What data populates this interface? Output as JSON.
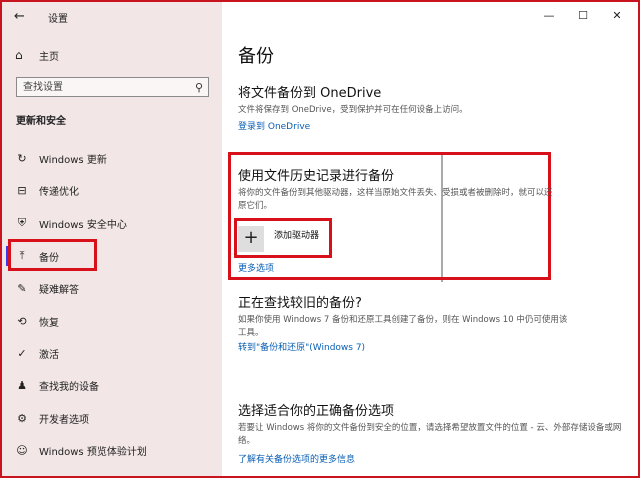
{
  "window": {
    "title": "设置",
    "controls": {
      "minimize": "—",
      "maximize": "☐",
      "close": "✕"
    }
  },
  "sidebar": {
    "back_icon": "←",
    "home_label": "主页",
    "search_placeholder": "查找设置",
    "section_title": "更新和安全",
    "items": [
      {
        "label": "Windows 更新",
        "icon": "refresh-icon",
        "glyph": "↻"
      },
      {
        "label": "传递优化",
        "icon": "delivery-icon",
        "glyph": "⊟"
      },
      {
        "label": "Windows 安全中心",
        "icon": "shield-icon",
        "glyph": "⛨"
      },
      {
        "label": "备份",
        "icon": "backup-icon",
        "glyph": "⤒",
        "selected": true
      },
      {
        "label": "疑难解答",
        "icon": "wrench-icon",
        "glyph": "✎"
      },
      {
        "label": "恢复",
        "icon": "recovery-icon",
        "glyph": "⟲"
      },
      {
        "label": "激活",
        "icon": "activation-icon",
        "glyph": "✓"
      },
      {
        "label": "查找我的设备",
        "icon": "find-device-icon",
        "glyph": "♟"
      },
      {
        "label": "开发者选项",
        "icon": "developer-icon",
        "glyph": "⚙"
      },
      {
        "label": "Windows 预览体验计划",
        "icon": "insider-icon",
        "glyph": "☺"
      }
    ]
  },
  "main": {
    "title": "备份",
    "onedrive": {
      "heading": "将文件备份到 OneDrive",
      "description": "文件将保存到 OneDrive，受到保护并可在任何设备上访问。",
      "link": "登录到 OneDrive"
    },
    "file_history": {
      "heading": "使用文件历史记录进行备份",
      "description": "将你的文件备份到其他驱动器，这样当原始文件丢失、受损或者被删除时，就可以还原它们。",
      "add_drive_glyph": "+",
      "add_drive_label": "添加驱动器",
      "more_options": "更多选项"
    },
    "older_backup": {
      "heading": "正在查找较旧的备份?",
      "description": "如果你使用 Windows 7 备份和还原工具创建了备份，则在 Windows 10 中仍可使用该工具。",
      "link": "转到\"备份和还原\"(Windows 7)"
    },
    "choose": {
      "heading": "选择适合你的正确备份选项",
      "description": "若要让 Windows 将你的文件备份到安全的位置，请选择希望放置文件的位置 - 云、外部存储设备或网络。",
      "link": "了解有关备份选项的更多信息"
    }
  },
  "colors": {
    "highlight": "#d8101a",
    "link": "#0a5fb4",
    "sidebar_bg": "#f2e6e6",
    "accent": "#3a3af0"
  }
}
